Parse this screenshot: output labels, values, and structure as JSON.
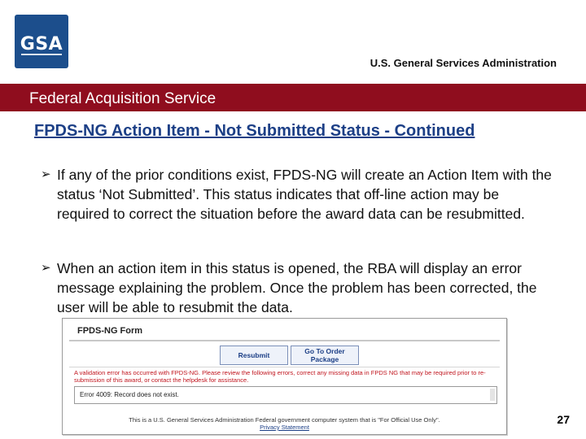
{
  "header": {
    "logo_text": "GSA",
    "agency": "U.S. General Services Administration",
    "band": "Federal Acquisition Service"
  },
  "slide": {
    "title": "FPDS-NG Action Item - Not Submitted Status - Continued",
    "bullet_icon": "arrow-bullet-icon",
    "bullets": [
      "If any of the prior conditions exist, FPDS-NG will create an Action Item with the status ‘Not Submitted’.  This status indicates that off-line action may be required to correct the situation before the award data can be resubmitted.",
      "When an action item in this status is opened, the RBA will display an error message explaining the problem.  Once the problem has been corrected, the user will be able to resubmit the data."
    ],
    "page_number": "27"
  },
  "screenshot": {
    "title": "FPDS-NG Form",
    "resubmit_label": "Resubmit",
    "order_label": "Go To Order Package",
    "message": "A validation error has occurred with FPDS-NG. Please review the following errors, correct any missing data in FPDS NG that may be required prior to re-submission of this award, or contact the helpdesk for assistance.",
    "error_text": "Error 4009: Record does not exist.",
    "footer": "This is a U.S. General Services Administration Federal government computer system that is \"For Official Use Only\".",
    "privacy_link": "Privacy Statement"
  },
  "colors": {
    "band": "#8f0d1e",
    "title": "#1c3f86",
    "logo": "#1c4e8c",
    "error": "#c0141d"
  }
}
